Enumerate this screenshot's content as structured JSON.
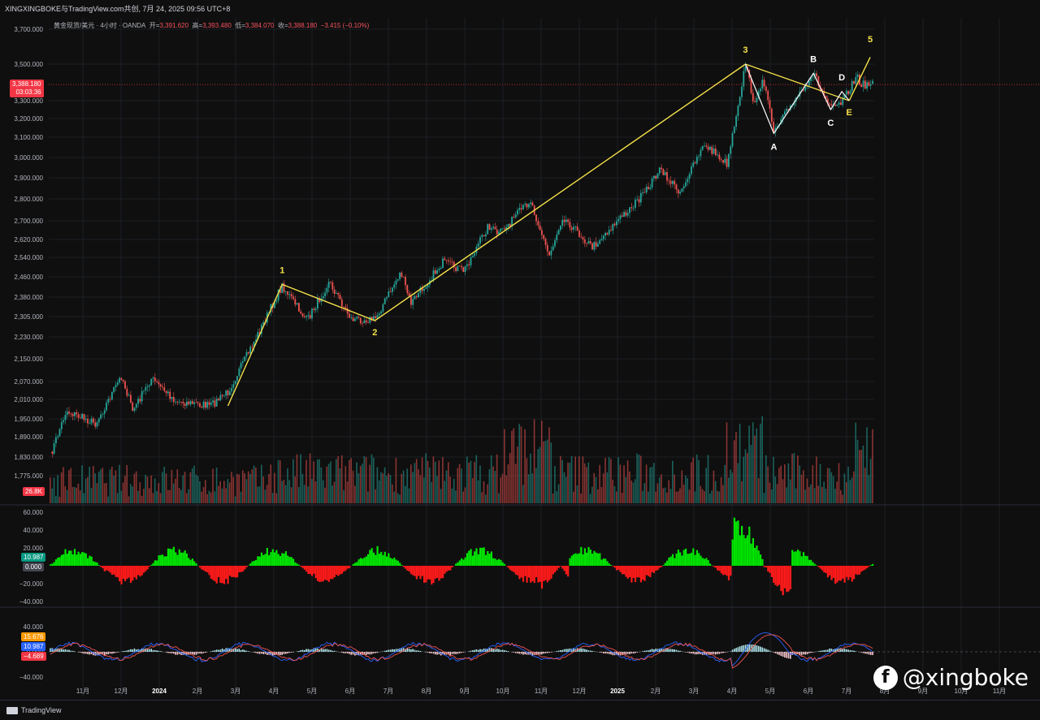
{
  "header": {
    "title": "XINGXINGBOKE与TradingView.com共创, 7月 24, 2025 09:56 UTC+8"
  },
  "legend": {
    "symbol": "黄金现货/美元 · 4小时 · OANDA",
    "open_label": "开=",
    "open": "3,391.620",
    "high_label": "高=",
    "high": "3,393.480",
    "low_label": "低=",
    "low": "3,384.070",
    "close_label": "收=",
    "close": "3,388.180",
    "change": "−3.415 (−0.10%)"
  },
  "price_badge": {
    "price": "3,388.180",
    "countdown": "03:03:36"
  },
  "volume_badge": "26.8K",
  "osc1_badge": {
    "value": "10.987",
    "zero": "0.000"
  },
  "osc2_badges": {
    "a": "15.676",
    "b": "10.987",
    "c": "−4.689"
  },
  "footer": {
    "brand": "TradingView"
  },
  "watermark": {
    "text": "@xingboke"
  },
  "colors": {
    "background": "#0f0f0f",
    "up": "#26a69a",
    "down": "#ef5350",
    "wave_yellow": "#f5e14a",
    "wave_white": "#ffffff",
    "osc_green": "#00e600",
    "osc_red": "#ff1a1a",
    "price_line": "#f23645"
  },
  "chart_data": [
    {
      "type": "line",
      "title": "黄金现货/美元 · 4小时 · OANDA",
      "y_axis_ticks": [
        "3,700.000",
        "3,500.000",
        "3,300.000",
        "3,200.000",
        "3,100.000",
        "3,000.000",
        "2,900.000",
        "2,800.000",
        "2,700.000",
        "2,620.000",
        "2,540.000",
        "2,460.000",
        "2,380.000",
        "2,305.000",
        "2,230.000",
        "2,150.000",
        "2,070.000",
        "2,010.000",
        "1,950.000",
        "1,890.000",
        "1,830.000",
        "1,775.000"
      ],
      "x_axis_ticks": [
        "11月",
        "12月",
        "2024",
        "2月",
        "3月",
        "4月",
        "5月",
        "6月",
        "7月",
        "8月",
        "9月",
        "10月",
        "11月",
        "12月",
        "2025",
        "2月",
        "3月",
        "4月",
        "5月",
        "6月",
        "7月",
        "8月",
        "9月",
        "10月",
        "11月"
      ],
      "price_path": [
        {
          "x": "2023-10-06",
          "y": 1820
        },
        {
          "x": "2023-10-20",
          "y": 1975
        },
        {
          "x": "2023-11-13",
          "y": 1935
        },
        {
          "x": "2023-12-04",
          "y": 2090
        },
        {
          "x": "2023-12-13",
          "y": 1975
        },
        {
          "x": "2023-12-28",
          "y": 2080
        },
        {
          "x": "2024-01-17",
          "y": 2005
        },
        {
          "x": "2024-02-14",
          "y": 1990
        },
        {
          "x": "2024-02-28",
          "y": 2035
        },
        {
          "x": "2024-03-20",
          "y": 2210
        },
        {
          "x": "2024-04-12",
          "y": 2425
        },
        {
          "x": "2024-05-02",
          "y": 2290
        },
        {
          "x": "2024-05-20",
          "y": 2440
        },
        {
          "x": "2024-06-07",
          "y": 2295
        },
        {
          "x": "2024-06-26",
          "y": 2295
        },
        {
          "x": "2024-07-17",
          "y": 2480
        },
        {
          "x": "2024-07-25",
          "y": 2355
        },
        {
          "x": "2024-08-20",
          "y": 2520
        },
        {
          "x": "2024-09-06",
          "y": 2485
        },
        {
          "x": "2024-09-26",
          "y": 2680
        },
        {
          "x": "2024-10-04",
          "y": 2640
        },
        {
          "x": "2024-10-30",
          "y": 2795
        },
        {
          "x": "2024-11-14",
          "y": 2545
        },
        {
          "x": "2024-11-25",
          "y": 2720
        },
        {
          "x": "2024-12-19",
          "y": 2585
        },
        {
          "x": "2025-01-02",
          "y": 2665
        },
        {
          "x": "2025-01-31",
          "y": 2830
        },
        {
          "x": "2025-02-11",
          "y": 2940
        },
        {
          "x": "2025-02-28",
          "y": 2835
        },
        {
          "x": "2025-03-20",
          "y": 3065
        },
        {
          "x": "2025-04-07",
          "y": 2970
        },
        {
          "x": "2025-04-22",
          "y": 3500
        },
        {
          "x": "2025-04-30",
          "y": 3260
        },
        {
          "x": "2025-05-06",
          "y": 3440
        },
        {
          "x": "2025-05-15",
          "y": 3120
        },
        {
          "x": "2025-05-30",
          "y": 3290
        },
        {
          "x": "2025-06-16",
          "y": 3450
        },
        {
          "x": "2025-06-30",
          "y": 3250
        },
        {
          "x": "2025-07-09",
          "y": 3285
        },
        {
          "x": "2025-07-15",
          "y": 3360
        },
        {
          "x": "2025-07-22",
          "y": 3440
        },
        {
          "x": "2025-07-24",
          "y": 3388
        }
      ],
      "current_price": 3388.18,
      "wave_labels": [
        {
          "label": "1",
          "x": "2024-04-12",
          "y": 2430,
          "color": "yellow"
        },
        {
          "label": "2",
          "x": "2024-06-26",
          "y": 2290,
          "color": "yellow"
        },
        {
          "label": "3",
          "x": "2025-04-22",
          "y": 3500,
          "color": "yellow"
        },
        {
          "label": "A",
          "x": "2025-05-15",
          "y": 3120,
          "color": "white"
        },
        {
          "label": "B",
          "x": "2025-06-16",
          "y": 3450,
          "color": "white"
        },
        {
          "label": "C",
          "x": "2025-06-30",
          "y": 3250,
          "color": "white"
        },
        {
          "label": "D",
          "x": "2025-07-09",
          "y": 3350,
          "color": "white"
        },
        {
          "label": "E",
          "x": "2025-07-15",
          "y": 3300,
          "color": "yellow"
        },
        {
          "label": "5",
          "x": "2025-08-01",
          "y": 3560,
          "color": "yellow"
        }
      ]
    },
    {
      "type": "area",
      "ylim": [
        -40,
        60
      ],
      "y_axis_ticks": [
        "60.000",
        "40.000",
        "20.000",
        "0.000",
        "−20.000",
        "−40.000"
      ]
    },
    {
      "type": "line",
      "ylim": [
        -40,
        40
      ],
      "y_axis_ticks": [
        "40.000",
        "0.000",
        "−40.000"
      ]
    }
  ]
}
